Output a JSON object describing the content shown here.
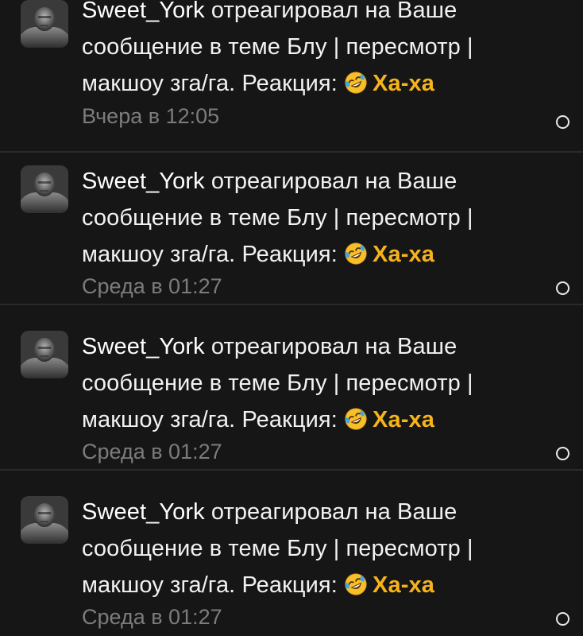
{
  "colors": {
    "background": "#161616",
    "text": "#f2f2f2",
    "reaction": "#f6b31b",
    "timestamp": "#7c7c7c",
    "divider": "#2a2a2a"
  },
  "notifications": [
    {
      "user": "Sweet_York",
      "message": " отреагировал на Ваше сообщение в теме Блу | пересмотр | макшоу зга/га. Реакция: ",
      "reaction_icon": "rofl-emoji-icon",
      "reaction": "Ха-ха",
      "time": "Вчера в 12:05"
    },
    {
      "user": "Sweet_York",
      "message": " отреагировал на Ваше сообщение в теме Блу | пересмотр | макшоу зга/га. Реакция: ",
      "reaction_icon": "rofl-emoji-icon",
      "reaction": "Ха-ха",
      "time": "Среда в 01:27"
    },
    {
      "user": "Sweet_York",
      "message": " отреагировал на Ваше сообщение в теме Блу | пересмотр | макшоу зга/га. Реакция: ",
      "reaction_icon": "rofl-emoji-icon",
      "reaction": "Ха-ха",
      "time": "Среда в 01:27"
    },
    {
      "user": "Sweet_York",
      "message": " отреагировал на Ваше сообщение в теме Блу | пересмотр | макшоу зга/га. Реакция: ",
      "reaction_icon": "rofl-emoji-icon",
      "reaction": "Ха-ха",
      "time": "Среда в 01:27"
    }
  ]
}
